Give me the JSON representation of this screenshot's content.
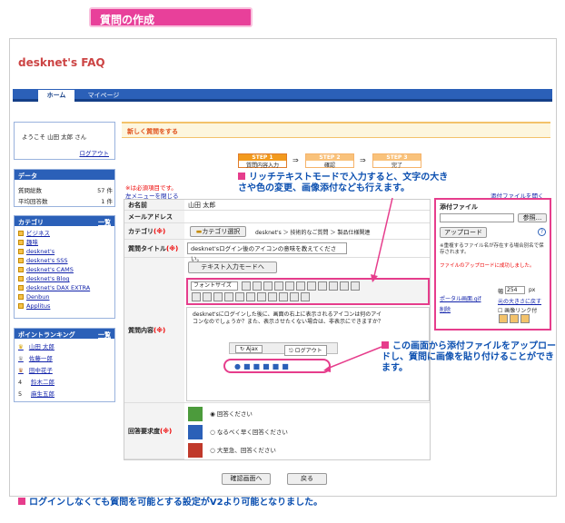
{
  "banner": {
    "title": "質問の作成"
  },
  "app": {
    "logo": "desknet's FAQ"
  },
  "nav": {
    "home": "ホーム",
    "mypage": "マイページ"
  },
  "user": {
    "welcome": "ようこそ 山田 太郎 さん",
    "logout": "ログアウト"
  },
  "data_box": {
    "title": "データ",
    "rows": [
      {
        "label": "質問総数",
        "value": "57 件"
      },
      {
        "label": "平均回答数",
        "value": "1 件"
      }
    ]
  },
  "category_box": {
    "title": "カテゴリ",
    "list_link": "一覧",
    "items": [
      "ビジネス",
      "趣味",
      "desknet's",
      "desknet's SSS",
      "desknet's CAMS",
      "desknet's Blog",
      "desknet's DAX EXTRA",
      "Denbun",
      "Applitus"
    ]
  },
  "ranking_box": {
    "title": "ポイントランキング",
    "list_link": "一覧",
    "items": [
      {
        "rank": "",
        "name": "山田 太郎"
      },
      {
        "rank": "",
        "name": "佐藤一郎"
      },
      {
        "rank": "",
        "name": "田中花子"
      },
      {
        "rank": "4",
        "name": "鈴木二郎"
      },
      {
        "rank": "5",
        "name": "麻生五郎"
      }
    ]
  },
  "main": {
    "section_title": "新しく質問をする",
    "steps": [
      {
        "step": "STEP 1",
        "label": "質問内容入力"
      },
      {
        "step": "STEP 2",
        "label": "確認"
      },
      {
        "step": "STEP 3",
        "label": "完了"
      }
    ],
    "required_note": "※は必須項目です。",
    "close_menu": "左メニューを閉じる",
    "open_attach": "添付ファイルを開く",
    "form": {
      "name_label": "お名前",
      "name_value": "山田 太郎",
      "email_label": "メールアドレス",
      "category_label": "カテゴリ",
      "category_button": "カテゴリ選択",
      "category_path": "desknet's ＞ 技術的なご質問 ＞ 製品仕様関連",
      "title_label": "質問タイトル",
      "title_value": "desknet'sログイン後のアイコンの意味を教えてください。",
      "content_label": "質問内容",
      "text_mode_button": "テキスト入力モードへ",
      "font_size_select": "フォントサイズ",
      "editor_text": "desknet'sにログインした後に、画面の右上に表示されるアイコンは何のアイコンなのでしょうか？また、表示させたくない場合は、非表示にできますか？",
      "ajax_label": "Ajax",
      "logout_label": "ログアウト",
      "priority_label": "回答要求度",
      "priority_options": [
        "回答ください",
        "なるべく早く回答ください",
        "大至急、回答ください"
      ],
      "confirm_button": "確認画面へ",
      "back_button": "戻る",
      "required_mark": "(※)"
    },
    "attach": {
      "title": "添付ファイル",
      "browse": "参照...",
      "upload": "アップロード",
      "help": "?",
      "note": "※重複するファイル名が存在する場合別名で保存されます。",
      "success": "ファイルのアップロードに成功しました。",
      "file_link": "ポータル画面.gif",
      "delete": "削除",
      "width_label": "幅",
      "width_value": "254",
      "unit": "px",
      "reset": "元の大きさに戻す",
      "link_check": "画像リンク付"
    }
  },
  "callouts": {
    "rich": "リッチテキストモードで入力すると、文字の大きさや色の変更、画像添付なども行えます。",
    "attach": "この画面から添付ファイルをアップロードし、質問に画像を貼り付けることができます。",
    "bottom": "ログインしなくても質問を可能とする設定がV2より可能となりました。"
  }
}
